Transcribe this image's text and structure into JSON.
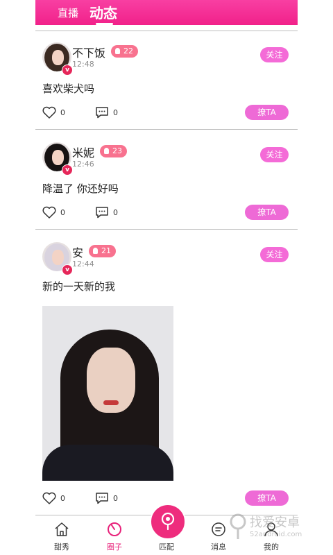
{
  "header": {
    "tabs": [
      {
        "label": "直播"
      },
      {
        "label": "动态"
      }
    ]
  },
  "posts": [
    {
      "name": "不下饭",
      "level": "22",
      "time": "12:48",
      "text": "喜欢柴犬吗",
      "likes": "0",
      "comments": "0",
      "follow_label": "关注",
      "flirt_label": "撩TA",
      "verified": "v"
    },
    {
      "name": "米妮",
      "level": "23",
      "time": "12:46",
      "text": "降温了 你还好吗",
      "likes": "0",
      "comments": "0",
      "follow_label": "关注",
      "flirt_label": "撩TA",
      "verified": "v"
    },
    {
      "name": "安",
      "level": "21",
      "time": "12:44",
      "text": "新的一天新的我",
      "likes": "0",
      "comments": "0",
      "follow_label": "关注",
      "flirt_label": "撩TA",
      "verified": "v"
    }
  ],
  "bottom_nav": [
    {
      "label": "甜秀",
      "icon": "home-icon"
    },
    {
      "label": "圈子",
      "icon": "circle-icon",
      "active": true
    },
    {
      "label": "匹配",
      "icon": "match-icon"
    },
    {
      "label": "消息",
      "icon": "message-icon"
    },
    {
      "label": "我的",
      "icon": "profile-icon"
    }
  ],
  "watermark": {
    "line1": "找爱安卓",
    "line2": "52android.com"
  },
  "colors": {
    "accent": "#f1218a",
    "follow": "#f46bd7",
    "level": "#f8728f",
    "active_nav": "#e8217a"
  }
}
